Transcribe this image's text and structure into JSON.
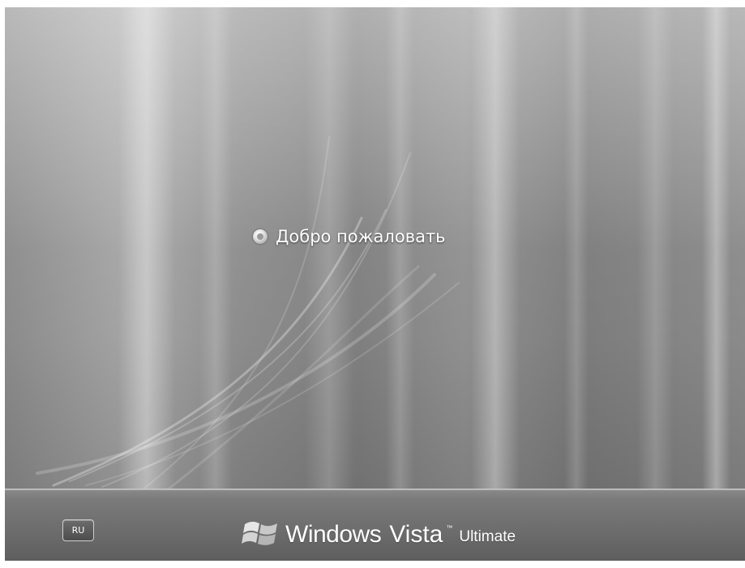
{
  "welcome": {
    "message": "Добро пожаловать"
  },
  "language": {
    "code": "RU"
  },
  "brand": {
    "windows": "Windows",
    "vista": "Vista",
    "trademark": "™",
    "edition": "Ultimate"
  },
  "colors": {
    "text": "#ffffff",
    "background": "#9a9a9a",
    "bar": "#6c6c6c"
  },
  "icons": {
    "spinner": "busy-spinner-icon",
    "logo": "windows-flag-icon"
  }
}
